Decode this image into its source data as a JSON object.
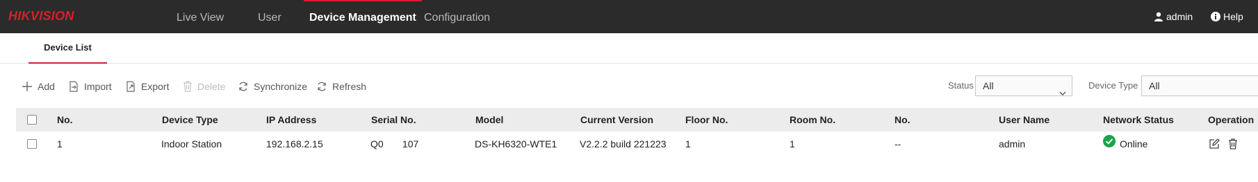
{
  "brand": {
    "logo_text": "HIKVISION",
    "logo_color": "#d6202b"
  },
  "nav": {
    "items": [
      {
        "label": "Live View",
        "active": false
      },
      {
        "label": "User",
        "active": false
      },
      {
        "label": "Device Management",
        "active": true
      },
      {
        "label": "Configuration",
        "active": false
      }
    ],
    "user_label": "admin",
    "help_label": "Help"
  },
  "tabs": [
    {
      "label": "Device List",
      "active": true
    }
  ],
  "toolbar": {
    "add": "Add",
    "import": "Import",
    "export": "Export",
    "delete": "Delete",
    "synchronize": "Synchronize",
    "refresh": "Refresh"
  },
  "filters": {
    "status_label": "Status",
    "status_value": "All",
    "device_type_label": "Device Type",
    "device_type_value": "All"
  },
  "table": {
    "columns": [
      "No.",
      "Device Type",
      "IP Address",
      "Serial No.",
      "Model",
      "Current Version",
      "Floor No.",
      "Room No.",
      "No.",
      "User Name",
      "Network Status",
      "Operation"
    ],
    "rows": [
      {
        "no": "1",
        "device_type": "Indoor Station",
        "ip_address": "192.168.2.15",
        "serial_no": "Q0       107",
        "model": "DS-KH6320-WTE1",
        "current_version": "V2.2.2 build 221223",
        "floor_no": "1",
        "room_no": "1",
        "no2": "--",
        "user_name": "admin",
        "network_status": "Online",
        "status_color": "#1aa34a"
      }
    ]
  },
  "colors": {
    "accent": "#d6202b",
    "topbar": "#2b2b2b",
    "online": "#1aa34a"
  }
}
